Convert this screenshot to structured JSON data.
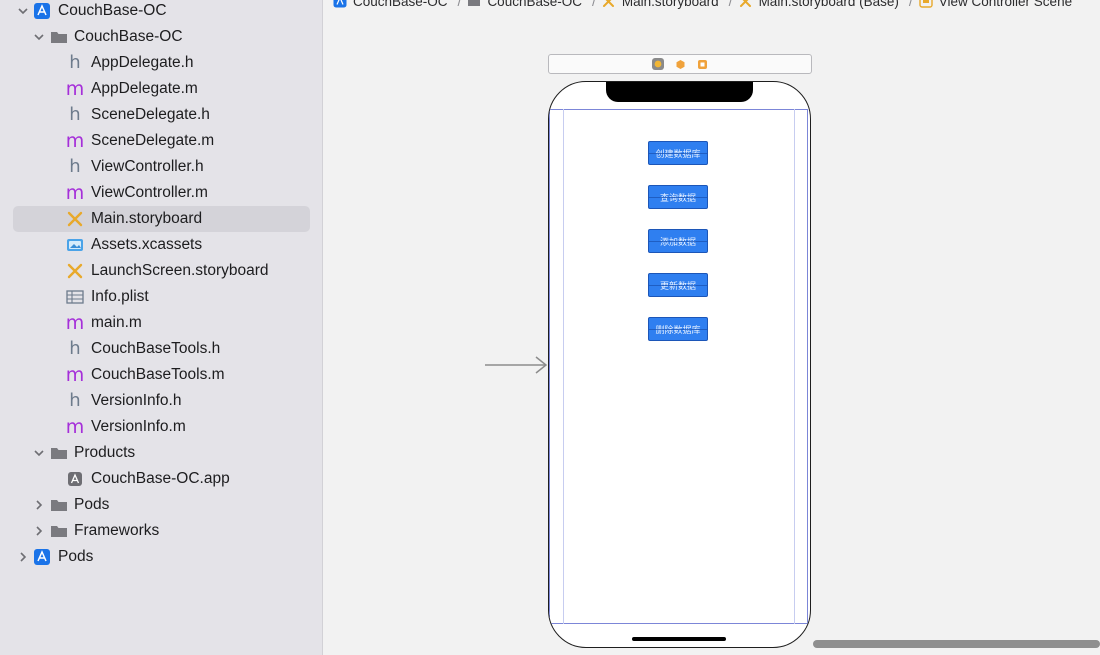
{
  "navigator": {
    "project": {
      "label": "CouchBase-OC",
      "icon": "xcode-project-icon"
    },
    "group": {
      "label": "CouchBase-OC",
      "icon": "folder-icon"
    },
    "files": [
      {
        "label": "AppDelegate.h",
        "icon": "header-file-icon"
      },
      {
        "label": "AppDelegate.m",
        "icon": "objc-file-icon"
      },
      {
        "label": "SceneDelegate.h",
        "icon": "header-file-icon"
      },
      {
        "label": "SceneDelegate.m",
        "icon": "objc-file-icon"
      },
      {
        "label": "ViewController.h",
        "icon": "header-file-icon"
      },
      {
        "label": "ViewController.m",
        "icon": "objc-file-icon"
      },
      {
        "label": "Main.storyboard",
        "icon": "storyboard-icon",
        "selected": true
      },
      {
        "label": "Assets.xcassets",
        "icon": "asset-catalog-icon"
      },
      {
        "label": "LaunchScreen.storyboard",
        "icon": "storyboard-icon"
      },
      {
        "label": "Info.plist",
        "icon": "plist-icon"
      },
      {
        "label": "main.m",
        "icon": "objc-file-icon"
      },
      {
        "label": "CouchBaseTools.h",
        "icon": "header-file-icon"
      },
      {
        "label": "CouchBaseTools.m",
        "icon": "objc-file-icon"
      },
      {
        "label": "VersionInfo.h",
        "icon": "header-file-icon"
      },
      {
        "label": "VersionInfo.m",
        "icon": "objc-file-icon"
      }
    ],
    "products": {
      "label": "Products",
      "child": "CouchBase-OC.app"
    },
    "pods_group": {
      "label": "Pods"
    },
    "frameworks_group": {
      "label": "Frameworks"
    },
    "pods_project": {
      "label": "Pods"
    }
  },
  "jumpbar": [
    "CouchBase-OC",
    "CouchBase-OC",
    "Main.storyboard",
    "Main.storyboard (Base)",
    "View Controller Scene"
  ],
  "canvas": {
    "buttons": [
      "创建数据库",
      "查询数据",
      "添加数据",
      "更新数据",
      "删除数据库"
    ]
  },
  "colors": {
    "accent": "#2f7ff0",
    "header_icon": "#6d7b8c",
    "objc_icon": "#a52fd9",
    "storyboard_icon": "#e8a92b"
  }
}
